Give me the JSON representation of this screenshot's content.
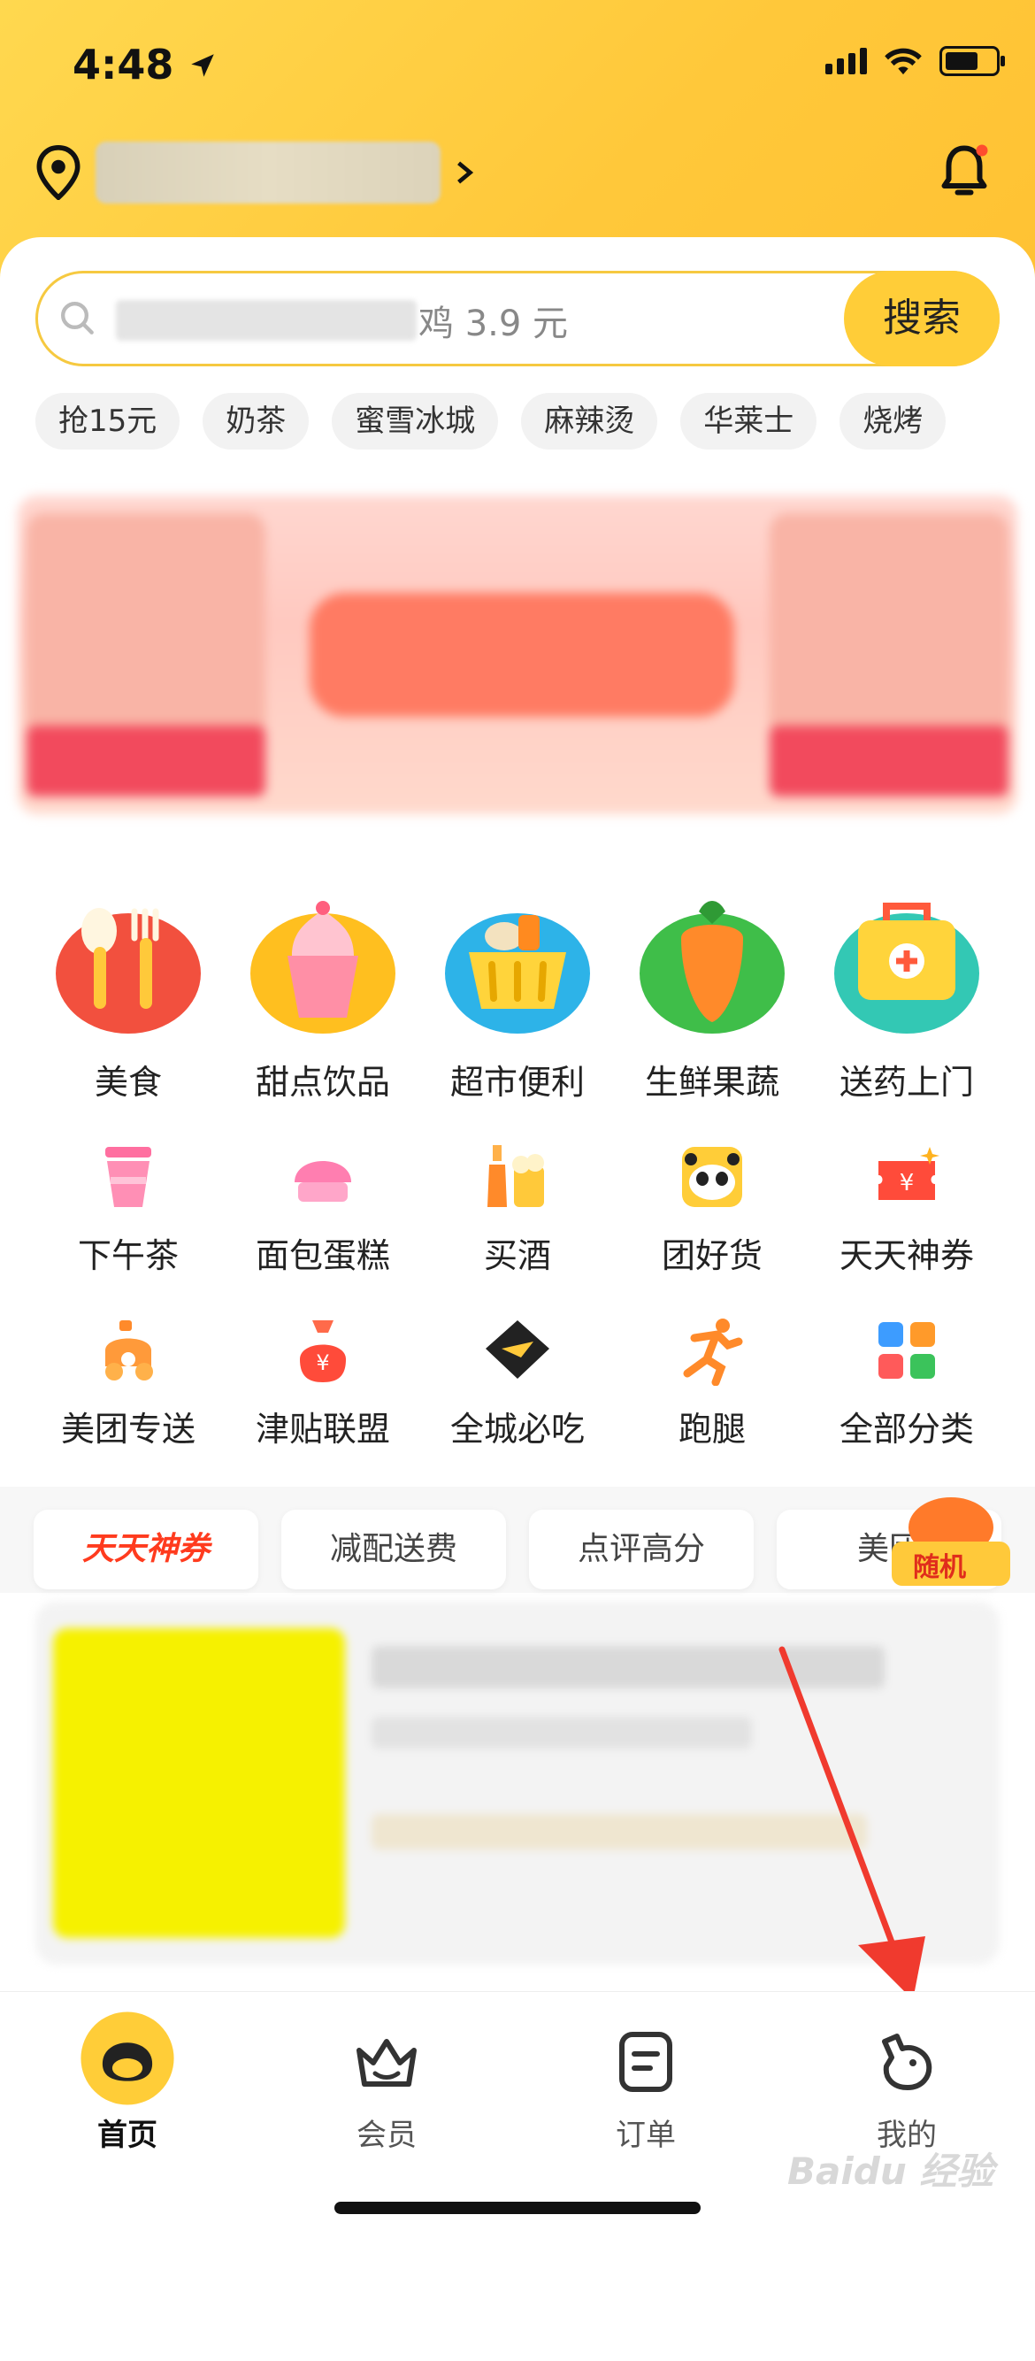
{
  "status": {
    "time": "4:48"
  },
  "search": {
    "placeholder_text": "鸡 3.9 元",
    "button": "搜索"
  },
  "chips": [
    "抢15元",
    "奶茶",
    "蜜雪冰城",
    "麻辣烫",
    "华莱士",
    "烧烤"
  ],
  "big_categories": [
    "美食",
    "甜点饮品",
    "超市便利",
    "生鲜果蔬",
    "送药上门"
  ],
  "small_categories_row1": [
    "下午茶",
    "面包蛋糕",
    "买酒",
    "团好货",
    "天天神券"
  ],
  "small_categories_row2": [
    "美团专送",
    "津贴联盟",
    "全城必吃",
    "跑腿",
    "全部分类"
  ],
  "tabs": [
    "天天神券",
    "减配送费",
    "点评高分",
    "美团"
  ],
  "float_badge": "随机",
  "nav": {
    "home": "首页",
    "member": "会员",
    "orders": "订单",
    "mine": "我的"
  },
  "watermark": "Baidu 经验",
  "colors": {
    "brand_yellow": "#ffcd38",
    "accent_red": "#ff3b1e",
    "arrow_red": "#f03a2e"
  }
}
